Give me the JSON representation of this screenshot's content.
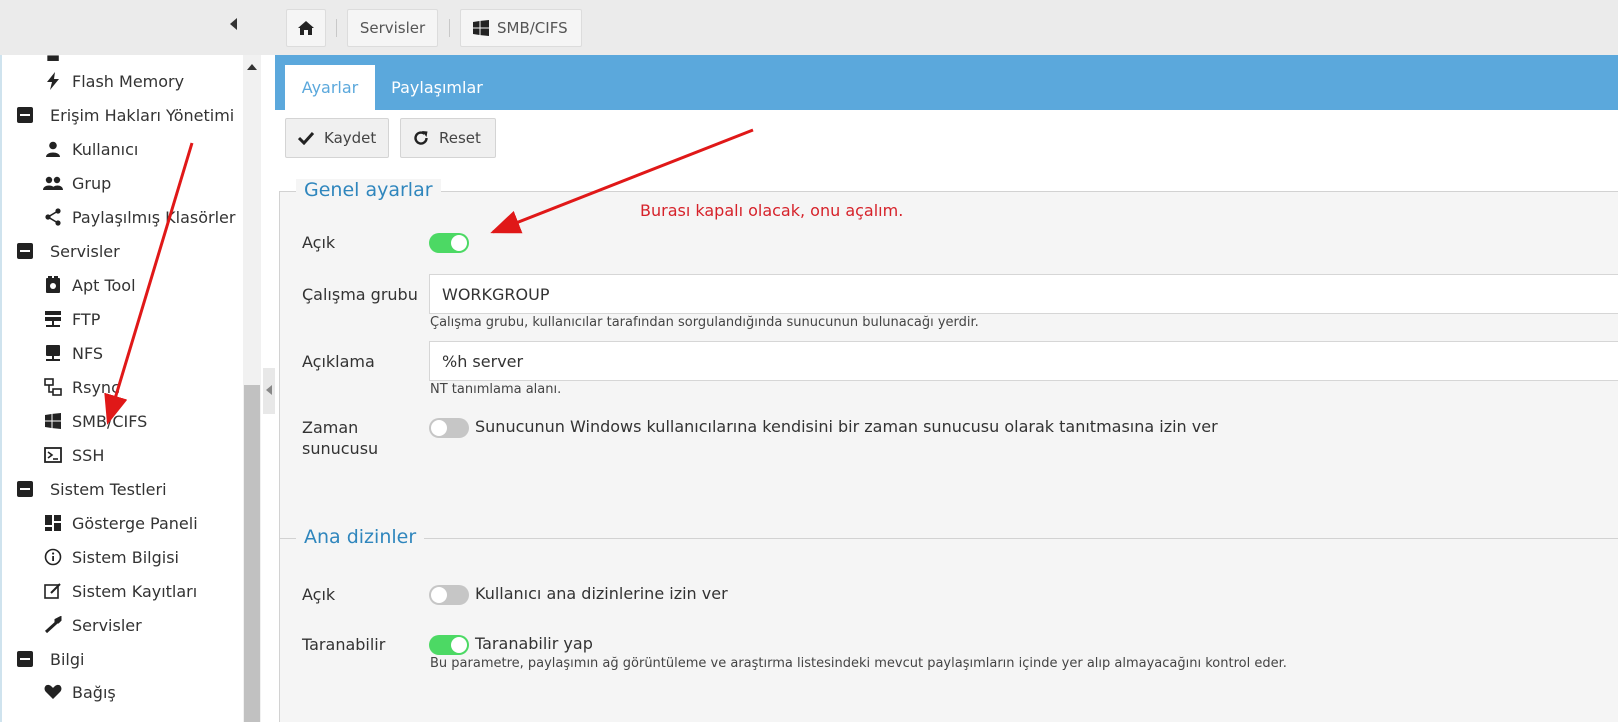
{
  "breadcrumb": {
    "home_icon": "home-icon",
    "items": [
      "Servisler",
      "SMB/CIFS"
    ]
  },
  "sidebar": {
    "items": [
      {
        "type": "item",
        "label": "Flash Memory",
        "icon": "flash-icon"
      },
      {
        "type": "group",
        "label": "Erişim Hakları Yönetimi",
        "icon": "collapse-icon"
      },
      {
        "type": "item",
        "label": "Kullanıcı",
        "icon": "user-icon"
      },
      {
        "type": "item",
        "label": "Grup",
        "icon": "group-icon"
      },
      {
        "type": "item",
        "label": "Paylaşılmış Klasörler",
        "icon": "share-icon"
      },
      {
        "type": "group",
        "label": "Servisler",
        "icon": "collapse-icon"
      },
      {
        "type": "item",
        "label": "Apt Tool",
        "icon": "apt-icon"
      },
      {
        "type": "item",
        "label": "FTP",
        "icon": "ftp-icon"
      },
      {
        "type": "item",
        "label": "NFS",
        "icon": "nfs-icon"
      },
      {
        "type": "item",
        "label": "Rsync",
        "icon": "rsync-icon"
      },
      {
        "type": "item",
        "label": "SMB/CIFS",
        "icon": "windows-icon"
      },
      {
        "type": "item",
        "label": "SSH",
        "icon": "terminal-icon"
      },
      {
        "type": "group",
        "label": "Sistem Testleri",
        "icon": "collapse-icon"
      },
      {
        "type": "item",
        "label": "Gösterge Paneli",
        "icon": "dashboard-icon"
      },
      {
        "type": "item",
        "label": "Sistem Bilgisi",
        "icon": "info-icon"
      },
      {
        "type": "item",
        "label": "Sistem Kayıtları",
        "icon": "log-icon"
      },
      {
        "type": "item",
        "label": "Servisler",
        "icon": "wrench-icon"
      },
      {
        "type": "group",
        "label": "Bilgi",
        "icon": "collapse-icon"
      },
      {
        "type": "item",
        "label": "Bağış",
        "icon": "heart-icon"
      }
    ]
  },
  "tabs": [
    "Ayarlar",
    "Paylaşımlar"
  ],
  "toolbar": {
    "save_label": "Kaydet",
    "reset_label": "Reset"
  },
  "general": {
    "title": "Genel ayarlar",
    "enabled_label": "Açık",
    "enabled": true,
    "workgroup_label": "Çalışma grubu",
    "workgroup_value": "WORKGROUP",
    "workgroup_hint": "Çalışma grubu, kullanıcılar tarafından sorgulandığında sunucunun bulunacağı yerdir.",
    "description_label": "Açıklama",
    "description_value": "%h server",
    "description_hint": "NT tanımlama alanı.",
    "timeserver_label_1": "Zaman",
    "timeserver_label_2": "sunucusu",
    "timeserver": false,
    "timeserver_text": "Sunucunun Windows kullanıcılarına kendisini bir zaman sunucusu olarak tanıtmasına izin ver"
  },
  "homes": {
    "title": "Ana dizinler",
    "enabled_label": "Açık",
    "enabled": false,
    "enabled_text": "Kullanıcı ana dizinlerine izin ver",
    "browsable_label": "Taranabilir",
    "browsable": true,
    "browsable_text": "Taranabilir yap",
    "browsable_hint": "Bu parametre, paylaşımın ağ görüntüleme ve araştırma listesindeki mevcut paylaşımların içinde yer alıp almayacağını kontrol eder."
  },
  "annotation": {
    "text": "Burası kapalı olacak, onu açalım.",
    "color": "#d6222a"
  },
  "colors": {
    "accent": "#5ba8dc",
    "switch_on": "#4cd964",
    "switch_off": "#c6c6c6",
    "legend": "#2f86bd"
  }
}
